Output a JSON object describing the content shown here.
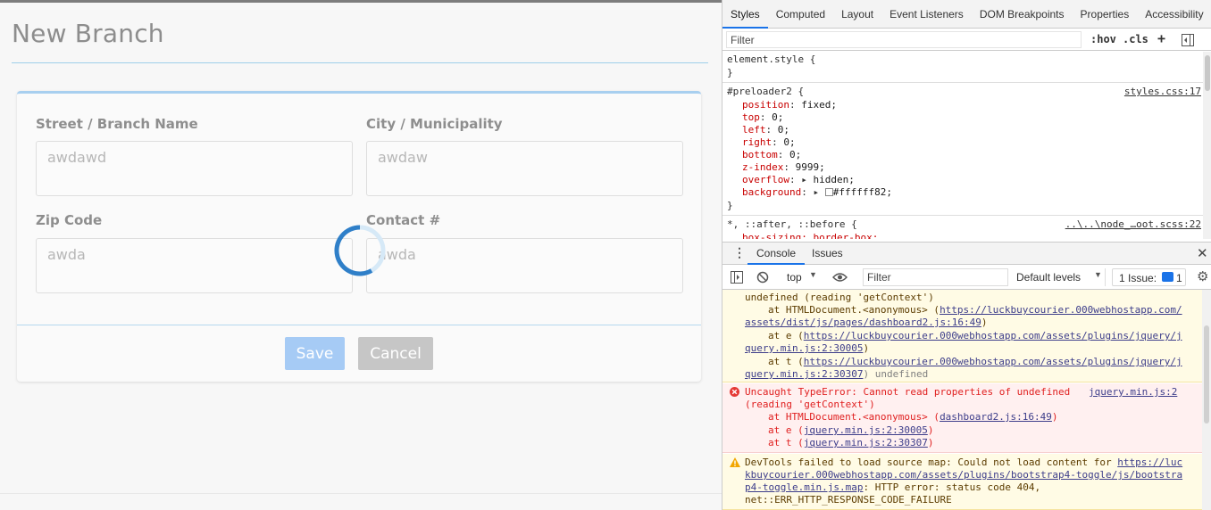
{
  "page": {
    "title": "New Branch",
    "fields": [
      {
        "label": "Street / Branch Name",
        "value": "awdawd"
      },
      {
        "label": "City / Municipality",
        "value": "awdaw"
      },
      {
        "label": "Zip Code",
        "value": "awda"
      },
      {
        "label": "Contact #",
        "value": "awda"
      }
    ],
    "save_label": "Save",
    "cancel_label": "Cancel"
  },
  "devtools": {
    "tabs": [
      "Styles",
      "Computed",
      "Layout",
      "Event Listeners",
      "DOM Breakpoints",
      "Properties",
      "Accessibility"
    ],
    "filter_placeholder": "Filter",
    "hov": ":hov",
    "cls": ".cls",
    "plus": "+",
    "styles": {
      "element_style_open": "element.style {",
      "close_brace": "}",
      "rule1_selector": "#preloader2 {",
      "rule1_source": "styles.css:17",
      "rule1_props": [
        {
          "name": "position",
          "value": "fixed;"
        },
        {
          "name": "top",
          "value": "0;"
        },
        {
          "name": "left",
          "value": "0;"
        },
        {
          "name": "right",
          "value": "0;"
        },
        {
          "name": "bottom",
          "value": "0;"
        },
        {
          "name": "z-index",
          "value": "9999;"
        },
        {
          "name": "overflow",
          "value": "hidden;"
        },
        {
          "name": "background",
          "value": "#ffffff82;"
        }
      ],
      "rule2_selector": "*, ::after, ::before {",
      "rule2_source": "..\\..\\node_…oot.scss:22",
      "rule2_prop": "box-sizing: border-box;",
      "swatch_color": "#ffffff82"
    },
    "drawer": {
      "tabs": [
        "Console",
        "Issues"
      ],
      "context": "top",
      "filter_placeholder": "Filter",
      "levels": "Default levels",
      "issues": "1 Issue:",
      "issues_count": "1"
    },
    "console": {
      "warn1": [
        "undefined (reading 'getContext')",
        "at HTMLDocument.<anonymous> (",
        "https://luckbuycourier.000webhostapp.com/",
        "assets/dist/js/pages/dashboard2.js:16:49",
        ")",
        "at e (",
        "https://luckbuycourier.000webhostapp.com/assets/plugins/jquery/j",
        "query.min.js:2:30005",
        ")",
        "at t (",
        "https://luckbuycourier.000webhostapp.com/assets/plugins/jquery/j",
        "query.min.js:2:30307",
        ") undefined"
      ],
      "err1": {
        "message": "Uncaught TypeError: Cannot read properties of undefined",
        "source": "jquery.min.js:2",
        "line2": "(reading 'getContext')",
        "s1_pre": "at HTMLDocument.<anonymous> (",
        "s1_link": "dashboard2.js:16:49",
        "s1_post": ")",
        "s2_pre": "at e (",
        "s2_link": "jquery.min.js:2:30005",
        "s2_post": ")",
        "s3_pre": "at t (",
        "s3_link": "jquery.min.js:2:30307",
        "s3_post": ")"
      },
      "warn2": {
        "pre": "DevTools failed to load source map: Could not load content for ",
        "link1": "https://luc",
        "link2": "kbuycourier.000webhostapp.com/assets/plugins/bootstrap4-toggle/js/bootstra",
        "link3": "p4-toggle.min.js.map",
        "post": ": HTTP error: status code 404,",
        "line4": "net::ERR_HTTP_RESPONSE_CODE_FAILURE"
      }
    }
  }
}
